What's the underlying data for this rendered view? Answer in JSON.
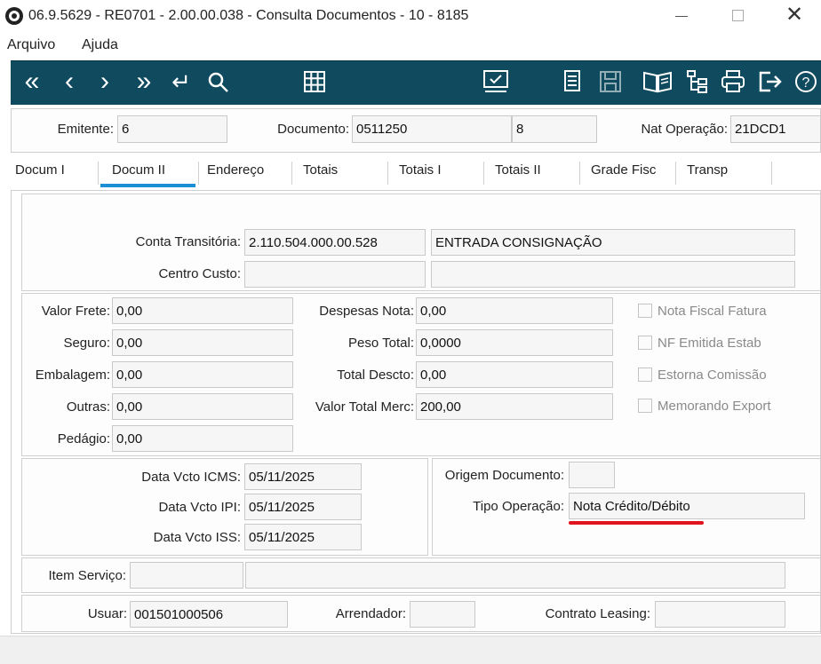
{
  "window": {
    "title": "06.9.5629 - RE0701 - 2.00.00.038 - Consulta Documentos - 10 - 8185"
  },
  "menu": {
    "items": [
      "Arquivo",
      "Ajuda"
    ]
  },
  "toolbar": {
    "left_icons": [
      "first-icon",
      "previous-icon",
      "next-icon",
      "last-icon",
      "goto-icon",
      "search-icon"
    ],
    "grid_icon": "grid-icon",
    "right_icons": [
      "monitor-check-icon",
      "document-list-icon",
      "save-icon",
      "book-icon",
      "tree-icon",
      "print-icon",
      "exit-icon",
      "help-icon"
    ]
  },
  "header": {
    "emitente_label": "Emitente:",
    "emitente_value": "6",
    "documento_label": "Documento:",
    "documento_value": "0511250",
    "serie_value": "8",
    "nat_operacao_label": "Nat Operação:",
    "nat_operacao_value": "21DCD1"
  },
  "tabs": [
    "Docum I",
    "Docum II",
    "Endereço",
    "Totais",
    "Totais I",
    "Totais II",
    "Grade Fisc",
    "Transp"
  ],
  "active_tab": "Docum II",
  "conta": {
    "conta_transitoria_label": "Conta Transitória:",
    "conta_transitoria_value": "2.110.504.000.00.528",
    "conta_transitoria_desc": "ENTRADA CONSIGNAÇÃO",
    "centro_custo_label": "Centro Custo:",
    "centro_custo_value": "",
    "centro_custo_desc": ""
  },
  "valores": {
    "valor_frete_label": "Valor Frete:",
    "valor_frete": "0,00",
    "seguro_label": "Seguro:",
    "seguro": "0,00",
    "embalagem_label": "Embalagem:",
    "embalagem": "0,00",
    "outras_label": "Outras:",
    "outras": "0,00",
    "pedagio_label": "Pedágio:",
    "pedagio": "0,00",
    "despesas_nota_label": "Despesas Nota:",
    "despesas_nota": "0,00",
    "peso_total_label": "Peso Total:",
    "peso_total": "0,0000",
    "total_descto_label": "Total Descto:",
    "total_descto": "0,00",
    "valor_total_merc_label": "Valor Total Merc:",
    "valor_total_merc": "200,00"
  },
  "checkboxes": [
    {
      "label": "Nota Fiscal Fatura",
      "checked": false
    },
    {
      "label": "NF Emitida Estab",
      "checked": false
    },
    {
      "label": "Estorna Comissão",
      "checked": false
    },
    {
      "label": "Memorando Export",
      "checked": false
    }
  ],
  "datas": {
    "icms_label": "Data Vcto ICMS:",
    "icms": "05/11/2025",
    "ipi_label": "Data Vcto IPI:",
    "ipi": "05/11/2025",
    "iss_label": "Data Vcto ISS:",
    "iss": "05/11/2025"
  },
  "origem": {
    "origem_label": "Origem Documento:",
    "origem_value": "",
    "tipo_operacao_label": "Tipo Operação:",
    "tipo_operacao_value": "Nota Crédito/Débito"
  },
  "item_servico": {
    "label": "Item Serviço:",
    "value": "",
    "desc": ""
  },
  "usuario": {
    "usuar_label": "Usuar:",
    "usuar_value": "001501000506",
    "arrendador_label": "Arrendador:",
    "arrendador_value": "",
    "contrato_label": "Contrato Leasing:",
    "contrato_value": ""
  },
  "colors": {
    "toolbar_bg": "#0f4a5e",
    "accent_tab": "#1a8fd6",
    "annotation_red": "#e0141e"
  }
}
